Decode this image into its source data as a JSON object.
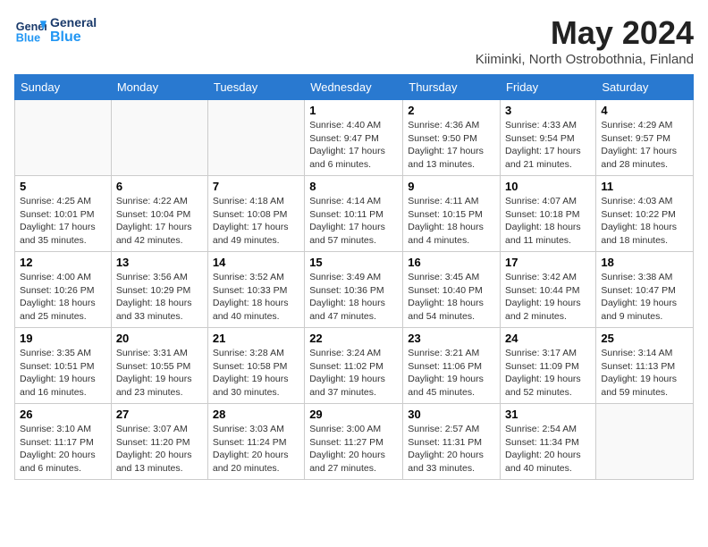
{
  "header": {
    "logo_general": "General",
    "logo_blue": "Blue",
    "month_year": "May 2024",
    "location": "Kiiminki, North Ostrobothnia, Finland"
  },
  "days_of_week": [
    "Sunday",
    "Monday",
    "Tuesday",
    "Wednesday",
    "Thursday",
    "Friday",
    "Saturday"
  ],
  "weeks": [
    [
      {
        "day": "",
        "info": ""
      },
      {
        "day": "",
        "info": ""
      },
      {
        "day": "",
        "info": ""
      },
      {
        "day": "1",
        "info": "Sunrise: 4:40 AM\nSunset: 9:47 PM\nDaylight: 17 hours and 6 minutes."
      },
      {
        "day": "2",
        "info": "Sunrise: 4:36 AM\nSunset: 9:50 PM\nDaylight: 17 hours and 13 minutes."
      },
      {
        "day": "3",
        "info": "Sunrise: 4:33 AM\nSunset: 9:54 PM\nDaylight: 17 hours and 21 minutes."
      },
      {
        "day": "4",
        "info": "Sunrise: 4:29 AM\nSunset: 9:57 PM\nDaylight: 17 hours and 28 minutes."
      }
    ],
    [
      {
        "day": "5",
        "info": "Sunrise: 4:25 AM\nSunset: 10:01 PM\nDaylight: 17 hours and 35 minutes."
      },
      {
        "day": "6",
        "info": "Sunrise: 4:22 AM\nSunset: 10:04 PM\nDaylight: 17 hours and 42 minutes."
      },
      {
        "day": "7",
        "info": "Sunrise: 4:18 AM\nSunset: 10:08 PM\nDaylight: 17 hours and 49 minutes."
      },
      {
        "day": "8",
        "info": "Sunrise: 4:14 AM\nSunset: 10:11 PM\nDaylight: 17 hours and 57 minutes."
      },
      {
        "day": "9",
        "info": "Sunrise: 4:11 AM\nSunset: 10:15 PM\nDaylight: 18 hours and 4 minutes."
      },
      {
        "day": "10",
        "info": "Sunrise: 4:07 AM\nSunset: 10:18 PM\nDaylight: 18 hours and 11 minutes."
      },
      {
        "day": "11",
        "info": "Sunrise: 4:03 AM\nSunset: 10:22 PM\nDaylight: 18 hours and 18 minutes."
      }
    ],
    [
      {
        "day": "12",
        "info": "Sunrise: 4:00 AM\nSunset: 10:26 PM\nDaylight: 18 hours and 25 minutes."
      },
      {
        "day": "13",
        "info": "Sunrise: 3:56 AM\nSunset: 10:29 PM\nDaylight: 18 hours and 33 minutes."
      },
      {
        "day": "14",
        "info": "Sunrise: 3:52 AM\nSunset: 10:33 PM\nDaylight: 18 hours and 40 minutes."
      },
      {
        "day": "15",
        "info": "Sunrise: 3:49 AM\nSunset: 10:36 PM\nDaylight: 18 hours and 47 minutes."
      },
      {
        "day": "16",
        "info": "Sunrise: 3:45 AM\nSunset: 10:40 PM\nDaylight: 18 hours and 54 minutes."
      },
      {
        "day": "17",
        "info": "Sunrise: 3:42 AM\nSunset: 10:44 PM\nDaylight: 19 hours and 2 minutes."
      },
      {
        "day": "18",
        "info": "Sunrise: 3:38 AM\nSunset: 10:47 PM\nDaylight: 19 hours and 9 minutes."
      }
    ],
    [
      {
        "day": "19",
        "info": "Sunrise: 3:35 AM\nSunset: 10:51 PM\nDaylight: 19 hours and 16 minutes."
      },
      {
        "day": "20",
        "info": "Sunrise: 3:31 AM\nSunset: 10:55 PM\nDaylight: 19 hours and 23 minutes."
      },
      {
        "day": "21",
        "info": "Sunrise: 3:28 AM\nSunset: 10:58 PM\nDaylight: 19 hours and 30 minutes."
      },
      {
        "day": "22",
        "info": "Sunrise: 3:24 AM\nSunset: 11:02 PM\nDaylight: 19 hours and 37 minutes."
      },
      {
        "day": "23",
        "info": "Sunrise: 3:21 AM\nSunset: 11:06 PM\nDaylight: 19 hours and 45 minutes."
      },
      {
        "day": "24",
        "info": "Sunrise: 3:17 AM\nSunset: 11:09 PM\nDaylight: 19 hours and 52 minutes."
      },
      {
        "day": "25",
        "info": "Sunrise: 3:14 AM\nSunset: 11:13 PM\nDaylight: 19 hours and 59 minutes."
      }
    ],
    [
      {
        "day": "26",
        "info": "Sunrise: 3:10 AM\nSunset: 11:17 PM\nDaylight: 20 hours and 6 minutes."
      },
      {
        "day": "27",
        "info": "Sunrise: 3:07 AM\nSunset: 11:20 PM\nDaylight: 20 hours and 13 minutes."
      },
      {
        "day": "28",
        "info": "Sunrise: 3:03 AM\nSunset: 11:24 PM\nDaylight: 20 hours and 20 minutes."
      },
      {
        "day": "29",
        "info": "Sunrise: 3:00 AM\nSunset: 11:27 PM\nDaylight: 20 hours and 27 minutes."
      },
      {
        "day": "30",
        "info": "Sunrise: 2:57 AM\nSunset: 11:31 PM\nDaylight: 20 hours and 33 minutes."
      },
      {
        "day": "31",
        "info": "Sunrise: 2:54 AM\nSunset: 11:34 PM\nDaylight: 20 hours and 40 minutes."
      },
      {
        "day": "",
        "info": ""
      }
    ]
  ]
}
